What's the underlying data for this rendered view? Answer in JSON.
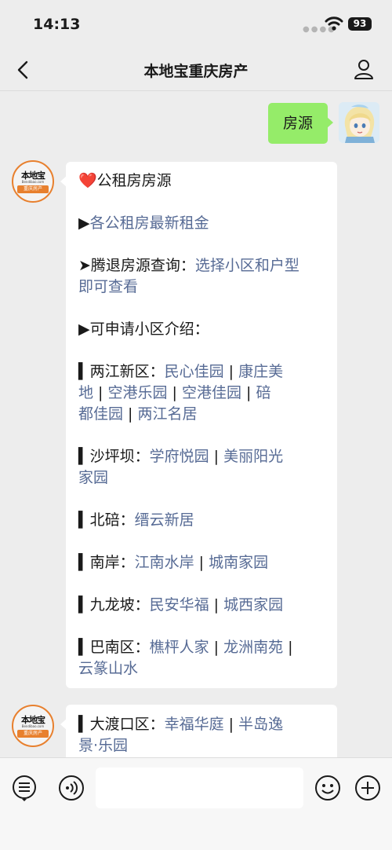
{
  "status_bar": {
    "time": "14:13",
    "battery": "93"
  },
  "header": {
    "title": "本地宝重庆房产"
  },
  "sender_logo": {
    "name": "本地宝",
    "domain": "Bendibao.com",
    "tag": "重庆房产"
  },
  "messages": {
    "sent_text": "房源",
    "intro": {
      "heart": "❤️",
      "text": "公租房房源"
    },
    "latest_rent": {
      "marker": "▶",
      "link": "各公租房最新租金"
    },
    "vacated": {
      "label": "➤腾退房源查询：",
      "link_a": "选择小区和户型",
      "link_b": "即可查看"
    },
    "apply_intro": "▶可申请小区介绍：",
    "l1": {
      "label": "▍两江新区：",
      "a": "民心佳园",
      "sep1": " | ",
      "b": "康庄美"
    },
    "l2": {
      "a": "地",
      "sep1": " | ",
      "b": "空港乐园",
      "sep2": " | ",
      "c": "空港佳园",
      "sep3": " | ",
      "d": "碚"
    },
    "l3": {
      "a": "都佳园",
      "sep1": " | ",
      "b": "两江名居"
    },
    "s1": {
      "label": "▍沙坪坝：",
      "a": "学府悦园",
      "sep1": " | ",
      "b": "美丽阳光"
    },
    "s2": {
      "a": "家园"
    },
    "b1": {
      "label": "▍北碚：",
      "a": "缙云新居"
    },
    "n1": {
      "label": "▍南岸：",
      "a": "江南水岸",
      "sep1": " | ",
      "b": "城南家园"
    },
    "j1": {
      "label": "▍九龙坡：",
      "a": "民安华福",
      "sep1": " | ",
      "b": "城西家园"
    },
    "bn1": {
      "label": "▍巴南区：",
      "a": "樵枰人家",
      "sep1": " | ",
      "b": "龙洲南苑",
      "sep2": " |"
    },
    "bn2": {
      "a": "云篆山水"
    },
    "d1": {
      "label": "▍大渡口区：",
      "a": "幸福华庭",
      "sep1": " | ",
      "b": "半岛逸"
    },
    "d2": {
      "a": "景·乐园"
    }
  },
  "icons": {
    "wifi": "wifi-icon",
    "back": "back-arrow-icon",
    "profile": "user-profile-icon",
    "menu": "chat-menu-icon",
    "voice": "voice-icon",
    "emoji": "emoji-icon",
    "add": "plus-icon"
  },
  "colors": {
    "link": "#576b95",
    "sent_bubble": "#95ec69",
    "logo_orange": "#e8802e",
    "background": "#ededed"
  }
}
